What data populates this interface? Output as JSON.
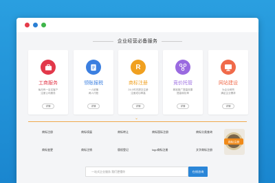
{
  "section_title": "企业经营必备服务",
  "cards": [
    {
      "name": "工商服务",
      "color": "#e2384a",
      "name_color": "#e2384a",
      "icon": "briefcase-icon",
      "desc": [
        "每月有一百名客户",
        "注册公司服务"
      ],
      "btn": "详情"
    },
    {
      "name": "领账报税",
      "color": "#3b7fe0",
      "name_color": "#3b7fe0",
      "icon": "doc-icon",
      "desc": [
        "一人统筹",
        "两人代账"
      ],
      "btn": "详情"
    },
    {
      "name": "商标注册",
      "color": "#f0a020",
      "name_color": "#f0a020",
      "icon": "r-icon",
      "desc": [
        "24小时内提交注册",
        "注册成功率高"
      ],
      "btn": "详情",
      "glyph": "R"
    },
    {
      "name": "竞价托管",
      "color": "#9a6ae0",
      "name_color": "#9a6ae0",
      "icon": "network-icon",
      "desc": [
        "精准推广提高效果",
        "提高转化率"
      ],
      "btn": "详情"
    },
    {
      "name": "网站建设",
      "color": "#f06a4a",
      "name_color": "#f06a4a",
      "icon": "monitor-icon",
      "desc": [
        "为企业网赞",
        "满足企业需求"
      ],
      "btn": "详情"
    }
  ],
  "links": [
    [
      "商标注册",
      "商标续展",
      "商标转让",
      "商标国际注册",
      "商标分类查询"
    ],
    [
      "商标变更",
      "商标注销",
      "版权登记",
      "logo商标注册",
      "文字商标注册"
    ]
  ],
  "badge_text": "商标注册",
  "search": {
    "placeholder": "一站式企业服务 我们更懂你",
    "button": "在线咨询"
  }
}
